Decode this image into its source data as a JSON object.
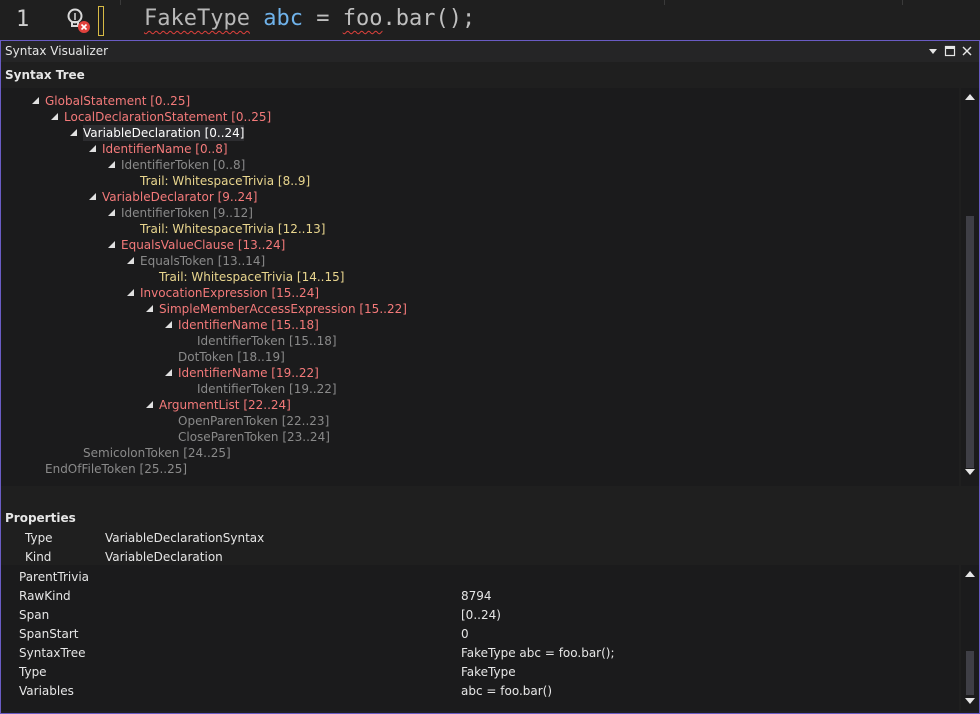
{
  "editor": {
    "line_number": "1",
    "code": {
      "type_name": "FakeType",
      "space1": " ",
      "identifier": "abc",
      "space2": " ",
      "equals": "=",
      "space3": " ",
      "target": "foo",
      "rest": ".bar();"
    },
    "error_icon": "lightbulb-error-icon"
  },
  "window": {
    "title": "Syntax Visualizer",
    "buttons": [
      "dropdown-icon",
      "maximize-icon",
      "close-icon"
    ]
  },
  "syntax_tree": {
    "header": "Syntax Tree",
    "nodes": [
      {
        "text": "GlobalStatement [0..25]",
        "kind": "node",
        "level": 0,
        "expanded": true
      },
      {
        "text": "LocalDeclarationStatement [0..25]",
        "kind": "node",
        "level": 1,
        "expanded": true
      },
      {
        "text": "VariableDeclaration [0..24]",
        "kind": "selected",
        "level": 2,
        "expanded": true
      },
      {
        "text": "IdentifierName [0..8]",
        "kind": "node",
        "level": 3,
        "expanded": true
      },
      {
        "text": "IdentifierToken [0..8]",
        "kind": "token",
        "level": 4,
        "expanded": true
      },
      {
        "text": "Trail: WhitespaceTrivia [8..9]",
        "kind": "trivia",
        "level": 5,
        "expanded": false
      },
      {
        "text": "VariableDeclarator [9..24]",
        "kind": "node",
        "level": 3,
        "expanded": true
      },
      {
        "text": "IdentifierToken [9..12]",
        "kind": "token",
        "level": 4,
        "expanded": true
      },
      {
        "text": "Trail: WhitespaceTrivia [12..13]",
        "kind": "trivia",
        "level": 5,
        "expanded": false
      },
      {
        "text": "EqualsValueClause [13..24]",
        "kind": "node",
        "level": 4,
        "expanded": true
      },
      {
        "text": "EqualsToken [13..14]",
        "kind": "token",
        "level": 5,
        "expanded": true
      },
      {
        "text": "Trail: WhitespaceTrivia [14..15]",
        "kind": "trivia",
        "level": 6,
        "expanded": false
      },
      {
        "text": "InvocationExpression [15..24]",
        "kind": "node",
        "level": 5,
        "expanded": true
      },
      {
        "text": "SimpleMemberAccessExpression [15..22]",
        "kind": "node",
        "level": 6,
        "expanded": true
      },
      {
        "text": "IdentifierName [15..18]",
        "kind": "node",
        "level": 7,
        "expanded": true
      },
      {
        "text": "IdentifierToken [15..18]",
        "kind": "token",
        "level": 8,
        "expanded": false
      },
      {
        "text": "DotToken [18..19]",
        "kind": "token",
        "level": 7,
        "expanded": false
      },
      {
        "text": "IdentifierName [19..22]",
        "kind": "node",
        "level": 7,
        "expanded": true
      },
      {
        "text": "IdentifierToken [19..22]",
        "kind": "token",
        "level": 8,
        "expanded": false
      },
      {
        "text": "ArgumentList [22..24]",
        "kind": "node",
        "level": 6,
        "expanded": true
      },
      {
        "text": "OpenParenToken [22..23]",
        "kind": "token",
        "level": 7,
        "expanded": false
      },
      {
        "text": "CloseParenToken [23..24]",
        "kind": "token",
        "level": 7,
        "expanded": false
      },
      {
        "text": "SemicolonToken [24..25]",
        "kind": "token",
        "level": 2,
        "expanded": false
      },
      {
        "text": "EndOfFileToken [25..25]",
        "kind": "token",
        "level": 0,
        "expanded": false
      }
    ]
  },
  "properties": {
    "header": "Properties",
    "type_label": "Type",
    "type_value": "VariableDeclarationSyntax",
    "kind_label": "Kind",
    "kind_value": "VariableDeclaration",
    "rows": [
      {
        "name": "ParentTrivia",
        "value": ""
      },
      {
        "name": "RawKind",
        "value": "8794"
      },
      {
        "name": "Span",
        "value": "[0..24)"
      },
      {
        "name": "SpanStart",
        "value": "0"
      },
      {
        "name": "SyntaxTree",
        "value": "FakeType abc = foo.bar();"
      },
      {
        "name": "Type",
        "value": "FakeType"
      },
      {
        "name": "Variables",
        "value": "abc = foo.bar()"
      }
    ]
  },
  "colors": {
    "node": "#f47a7a",
    "token": "#8a8a8a",
    "trivia": "#e9d68e",
    "accent_border": "#6a5cc4",
    "error_squiggle": "#e0413c"
  }
}
